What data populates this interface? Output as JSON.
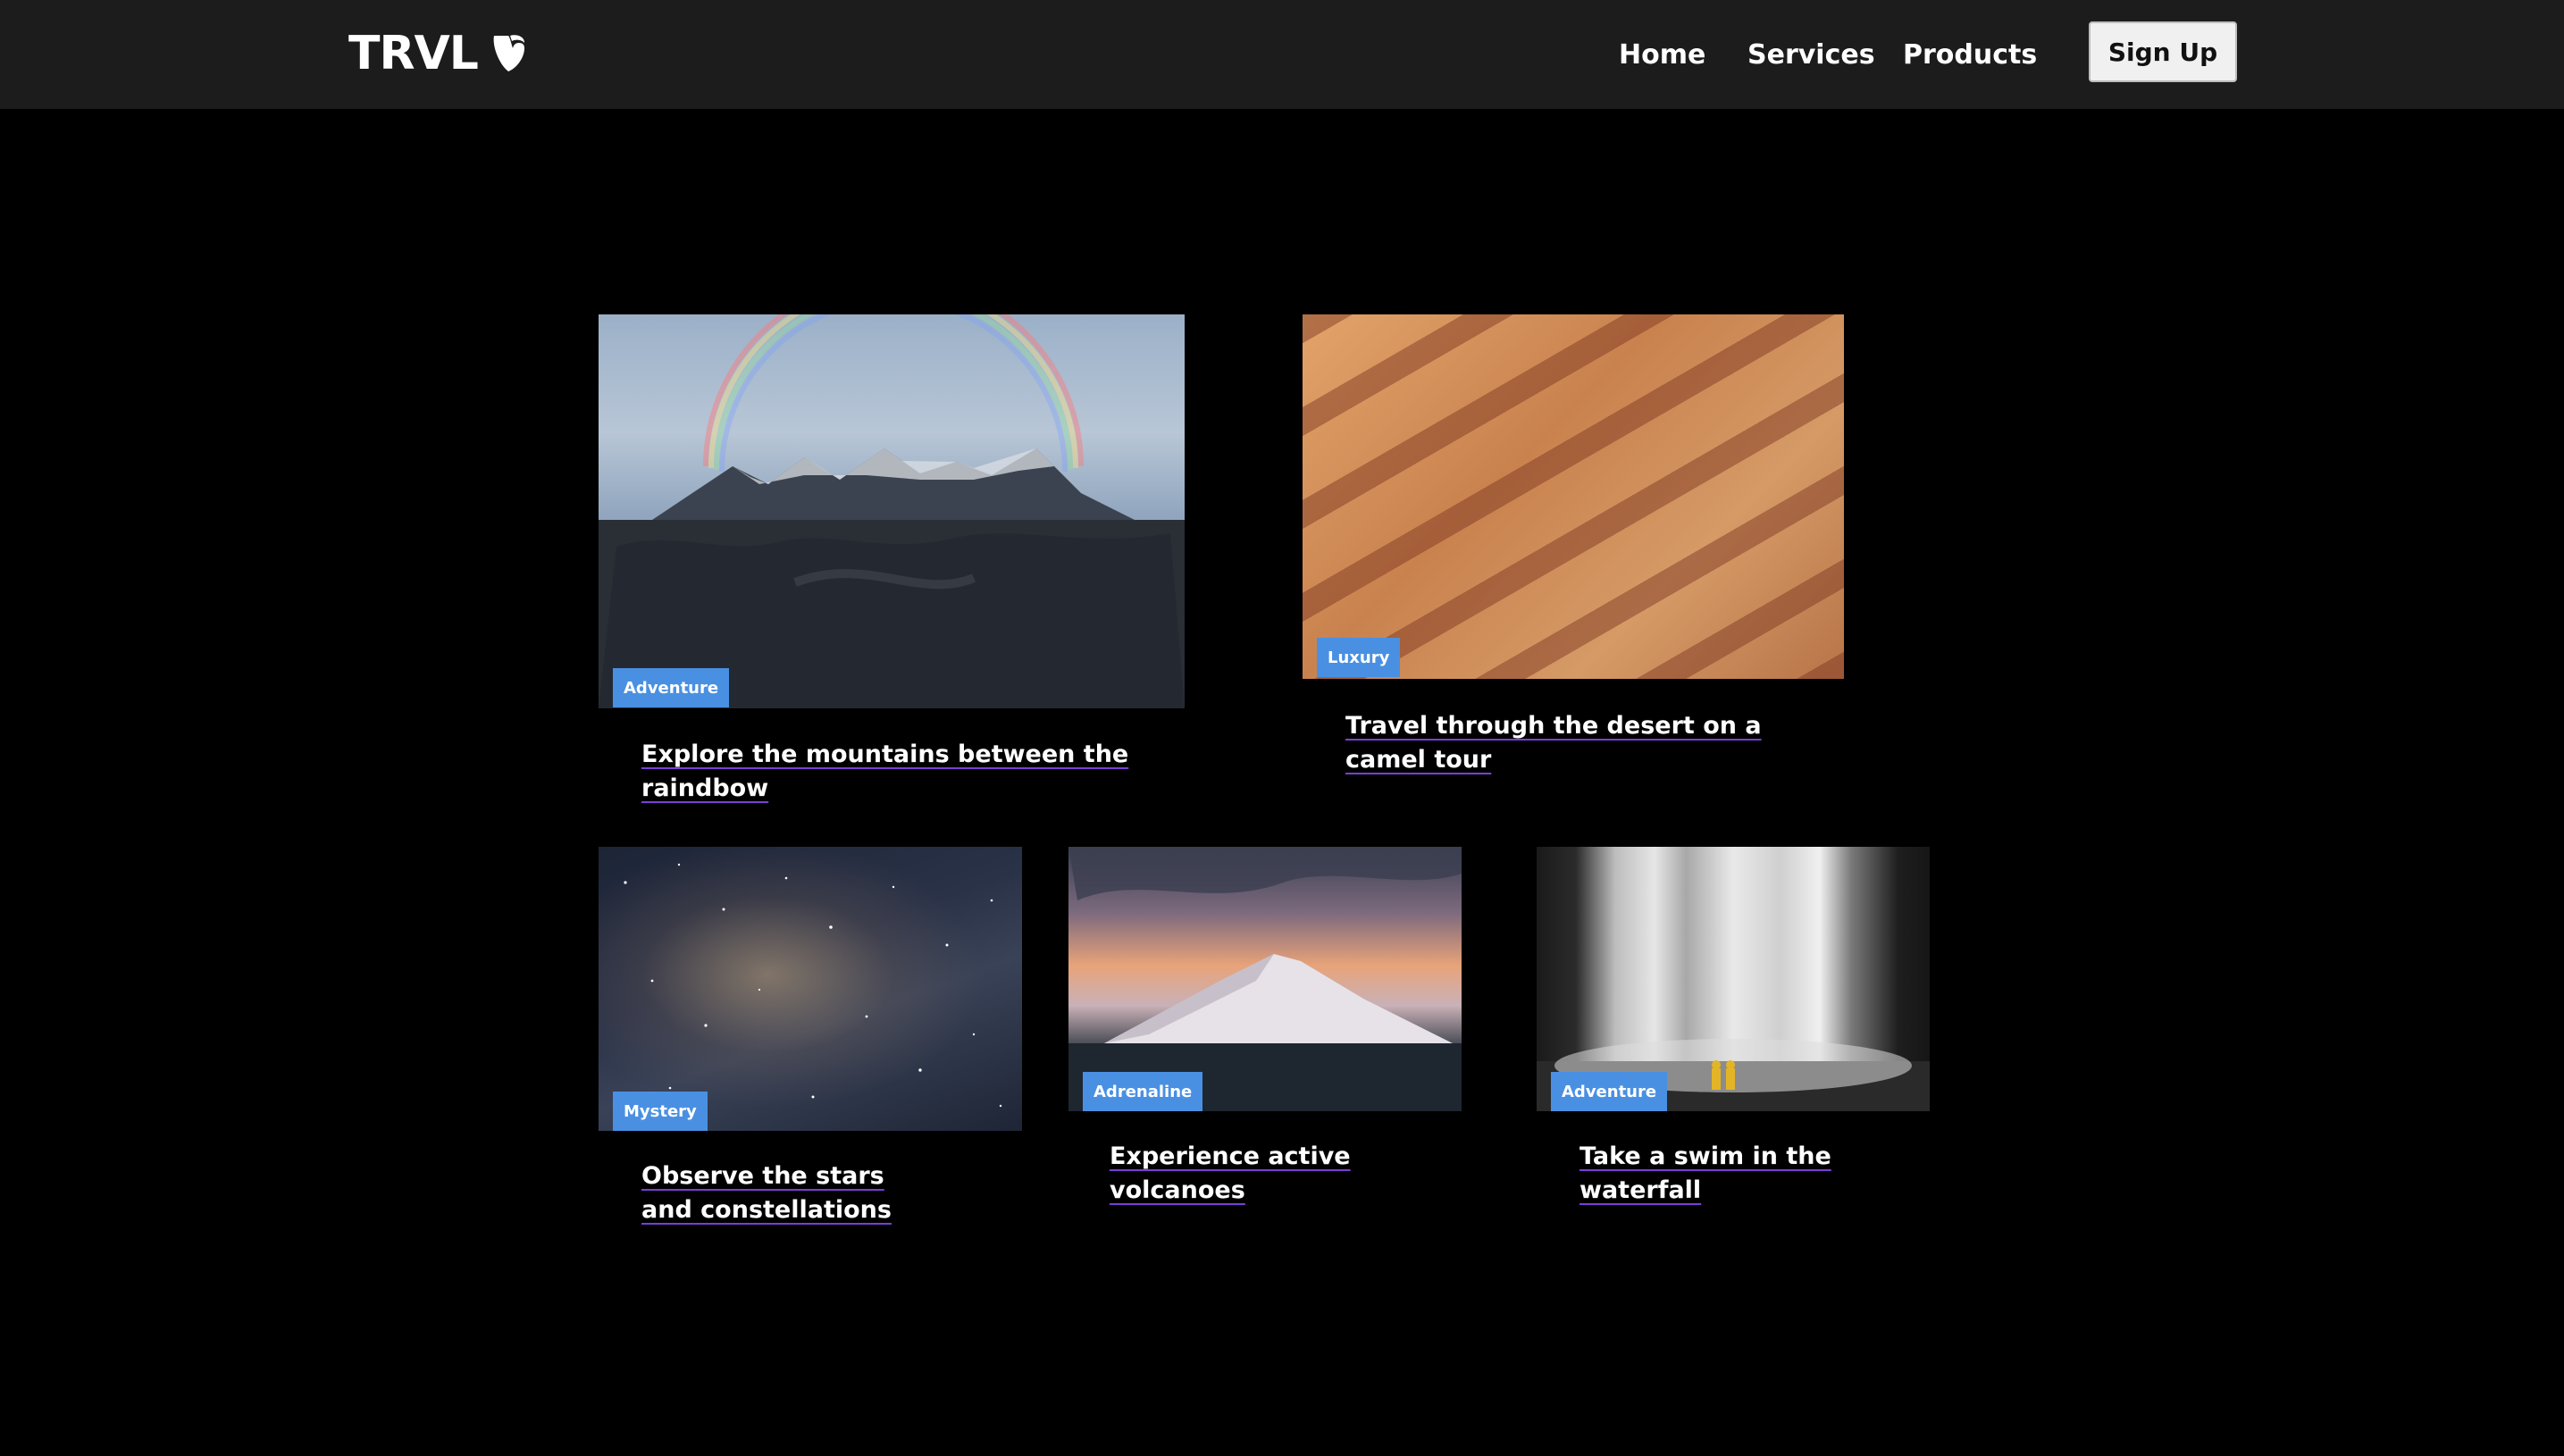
{
  "brand": {
    "name": "TRVL",
    "logo_icon": "typo3-logo-icon"
  },
  "nav": {
    "items": [
      {
        "label": "Home"
      },
      {
        "label": "Services"
      },
      {
        "label": "Products"
      }
    ],
    "cta_label": "Sign Up"
  },
  "cards": [
    {
      "badge": "Adventure",
      "title": "Explore the mountains between the raindbow"
    },
    {
      "badge": "Luxury",
      "title": "Travel through the desert on a camel tour"
    },
    {
      "badge": "Mystery",
      "title": "Observe the stars and constellations"
    },
    {
      "badge": "Adrenaline",
      "title": "Experience active volcanoes"
    },
    {
      "badge": "Adventure",
      "title": "Take a swim in the waterfall"
    }
  ],
  "colors": {
    "page_bg": "#000000",
    "header_bg": "#1c1c1c",
    "badge_bg": "#4a90e2",
    "link_underline": "#7a3fd6"
  }
}
